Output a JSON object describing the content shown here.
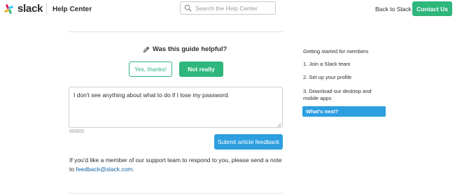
{
  "header": {
    "logo_text": "slack",
    "help_center": "Help Center",
    "search_placeholder": "Search the Help Center",
    "back_link": "Back to Slack",
    "contact_button": "Contact Us"
  },
  "feedback": {
    "question": "Was this guide helpful?",
    "yes_label": "Yes, thanks!",
    "no_label": "Not really",
    "textarea_value": "I don't see anything about what to do if I lose my password.",
    "char_count": "60/800",
    "submit_label": "Submit article feedback",
    "note_prefix": "If you'd like a member of our support team to respond to you, please send a note to",
    "note_email": "feedback@slack.com",
    "note_suffix": "."
  },
  "sidebar": {
    "heading": "Getting started for members",
    "items": [
      {
        "label": "1. Join a Slack team"
      },
      {
        "label": "2. Set up your profile"
      },
      {
        "label": "3. Download our desktop and mobile apps"
      },
      {
        "label": "What's next?"
      }
    ]
  },
  "colors": {
    "brand_green": "#2eb67d",
    "accent_blue": "#2d9ee0",
    "link_blue": "#1264a3"
  }
}
